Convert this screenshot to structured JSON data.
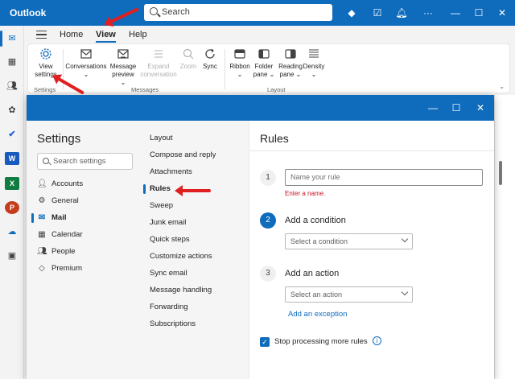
{
  "titlebar": {
    "app_name": "Outlook",
    "search_placeholder": "Search"
  },
  "ribbon_tabs": [
    "Home",
    "View",
    "Help"
  ],
  "ribbon": {
    "buttons": {
      "view_settings": [
        "View",
        "settings"
      ],
      "conversations": "Conversations",
      "message_preview": [
        "Message",
        "preview"
      ],
      "expand_conversation": [
        "Expand",
        "conversation"
      ],
      "zoom": "Zoom",
      "sync": "Sync",
      "ribbon": "Ribbon",
      "folder_pane": [
        "Folder",
        "pane"
      ],
      "reading_pane": [
        "Reading",
        "pane"
      ],
      "density": "Density"
    },
    "groups": {
      "settings": "Settings",
      "messages": "Messages",
      "layout": "Layout"
    }
  },
  "settings": {
    "title": "Settings",
    "search_placeholder": "Search settings",
    "categories": [
      "Accounts",
      "General",
      "Mail",
      "Calendar",
      "People",
      "Premium"
    ],
    "active_category": "Mail",
    "mail_sections": [
      "Layout",
      "Compose and reply",
      "Attachments",
      "Rules",
      "Sweep",
      "Junk email",
      "Quick steps",
      "Customize actions",
      "Sync email",
      "Message handling",
      "Forwarding",
      "Subscriptions"
    ],
    "active_section": "Rules"
  },
  "rules": {
    "title": "Rules",
    "step1": "1",
    "step2": "2",
    "step3": "3",
    "name_placeholder": "Name your rule",
    "name_error": "Enter a name.",
    "add_condition": "Add a condition",
    "select_condition": "Select a condition",
    "add_action": "Add an action",
    "select_action": "Select an action",
    "add_exception": "Add an exception",
    "stop_processing": "Stop processing more rules",
    "stop_processing_checked": true
  },
  "colors": {
    "brand": "#0f6cbd",
    "error": "#c50f1f",
    "annotation_arrow": "#e02020"
  }
}
